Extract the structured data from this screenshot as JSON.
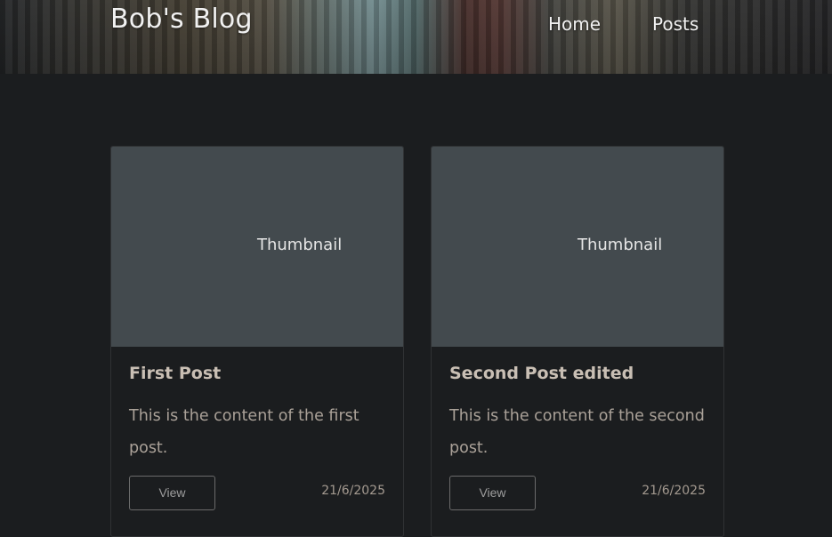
{
  "header": {
    "brand": "Bob's Blog",
    "nav": [
      {
        "label": "Home"
      },
      {
        "label": "Posts"
      }
    ]
  },
  "posts": [
    {
      "thumbnail_label": "Thumbnail",
      "title": "First Post",
      "content": "This is the content of the first post.",
      "view_label": "View",
      "date": "21/6/2025"
    },
    {
      "thumbnail_label": "Thumbnail",
      "title": "Second Post edited",
      "content": "This is the content of the second post.",
      "view_label": "View",
      "date": "21/6/2025"
    }
  ]
}
